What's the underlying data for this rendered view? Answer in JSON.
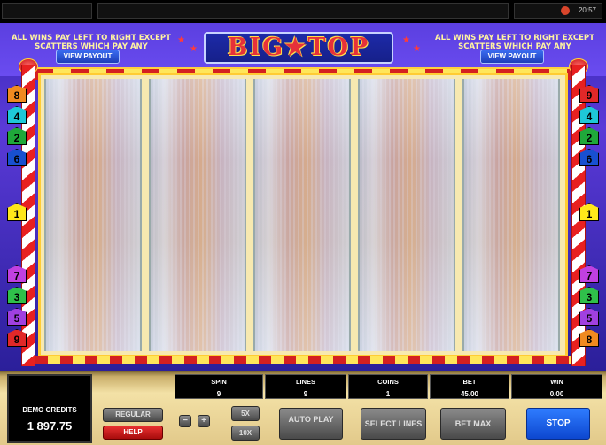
{
  "topbar": {
    "clock": "20:57"
  },
  "game": {
    "title": "BIG★TOP",
    "pay_text_left": "ALL WINS PAY LEFT TO RIGHT EXCEPT SCATTERS WHICH PAY ANY",
    "pay_text_right": "ALL WINS PAY LEFT TO RIGHT EXCEPT SCATTERS WHICH PAY ANY",
    "view_payout_left": "VIEW PAYOUT",
    "view_payout_right": "VIEW PAYOUT",
    "left_markers": [
      "8",
      "4",
      "2",
      "6",
      "1",
      "7",
      "3",
      "5",
      "9"
    ],
    "right_markers": [
      "9",
      "4",
      "2",
      "6",
      "1",
      "7",
      "3",
      "5",
      "8"
    ],
    "marker_colors": {
      "1": "#ffe81a",
      "2": "#1fa83a",
      "3": "#2fc04a",
      "4": "#1ec8d8",
      "5": "#a040e0",
      "6": "#1850d0",
      "7": "#c040e0",
      "8": "#f08a20",
      "9": "#e02828"
    }
  },
  "panel": {
    "credits_label": "DEMO CREDITS",
    "credits_value": "1 897.75",
    "spin_label": "SPIN",
    "spin_value": "9",
    "lines_label": "LINES",
    "lines_value": "9",
    "coins_label": "COINS",
    "coins_value": "1",
    "bet_label": "BET",
    "bet_value": "45.00",
    "win_label": "WIN",
    "win_value": "0.00",
    "regular_label": "REGULAR",
    "help_label": "HELP",
    "minus_label": "−",
    "plus_label": "+",
    "x5_label": "5X",
    "x10_label": "10X",
    "autoplay_label": "AUTO PLAY",
    "select_lines_label": "SELECT LINES",
    "bet_max_label": "BET MAX",
    "stop_label": "STOP"
  }
}
